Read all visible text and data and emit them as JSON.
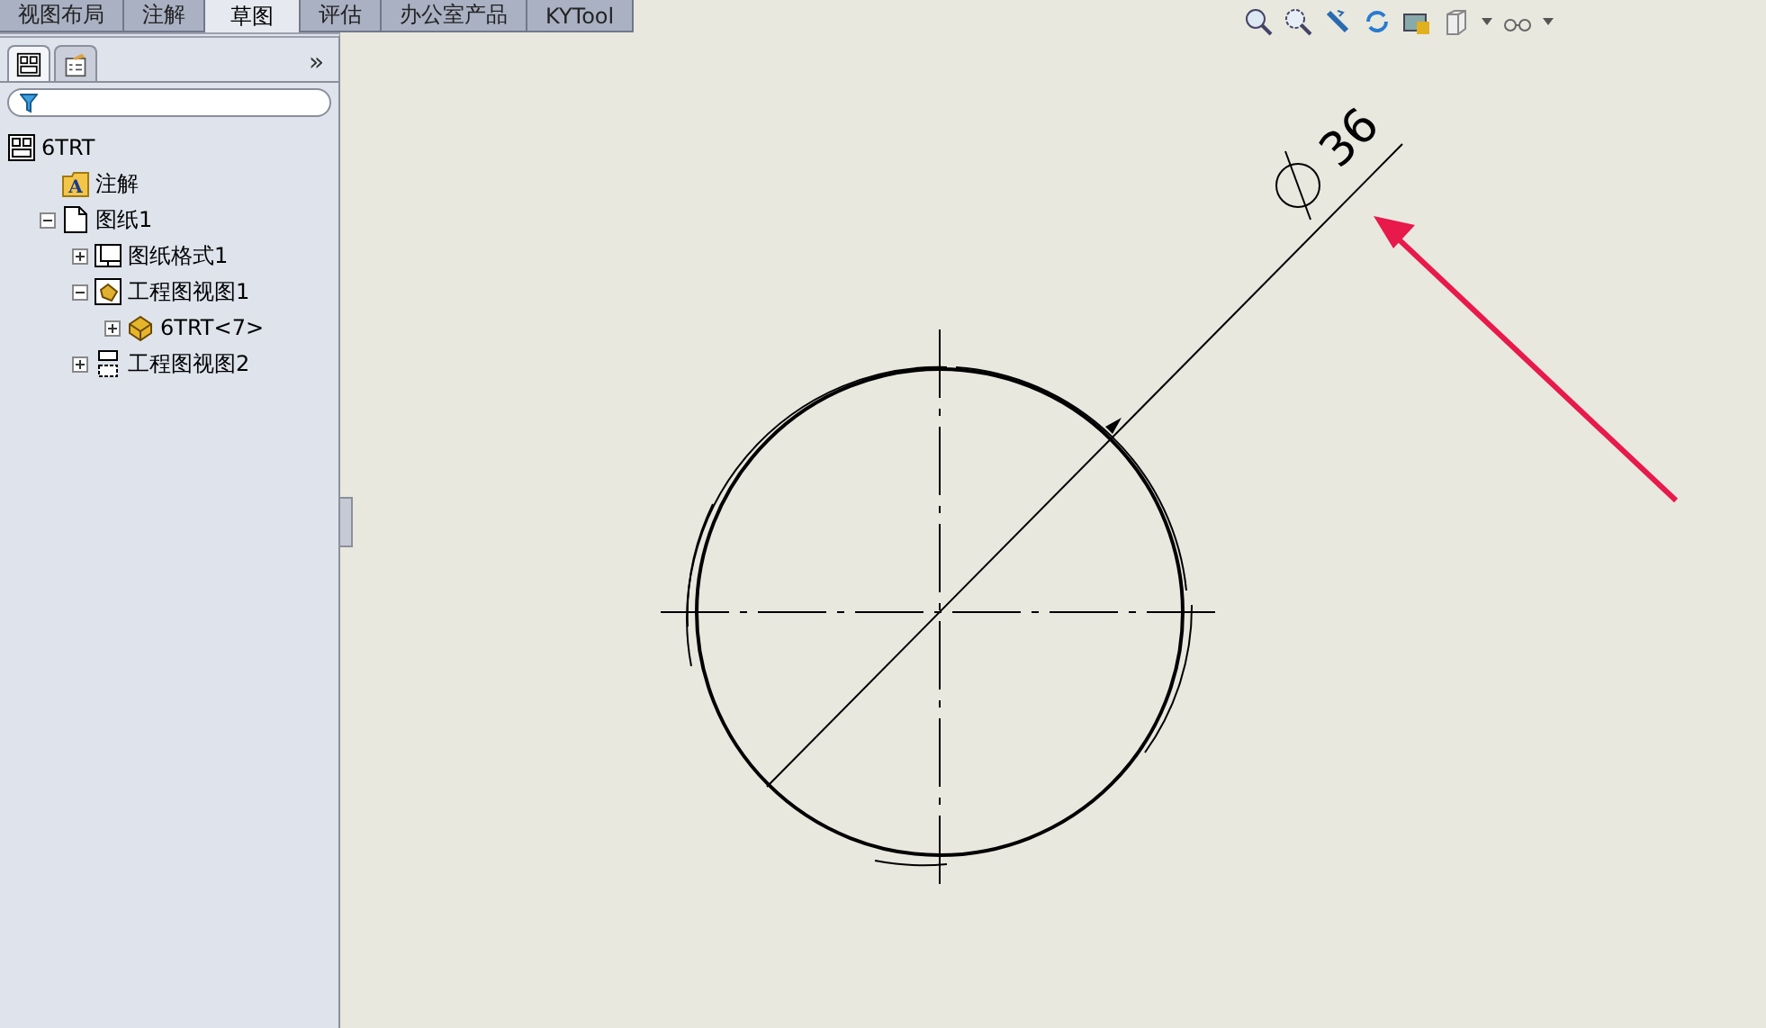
{
  "command_tabs": [
    {
      "label": "视图布局",
      "selected": false
    },
    {
      "label": "注解",
      "selected": false
    },
    {
      "label": "草图",
      "selected": true
    },
    {
      "label": "评估",
      "selected": false
    },
    {
      "label": "办公室产品",
      "selected": false
    },
    {
      "label": "KYTool",
      "selected": false
    }
  ],
  "panel_tabs": [
    {
      "kind": "tree",
      "selected": true
    },
    {
      "kind": "properties",
      "selected": false
    }
  ],
  "panel_expand": "»",
  "tree": [
    {
      "label": "6TRT",
      "kind": "drawing",
      "children": [
        {
          "label": "注解",
          "kind": "annotation",
          "icon_letter": "A"
        },
        {
          "label": "图纸1",
          "kind": "sheet",
          "expanded": true,
          "children": [
            {
              "label": "图纸格式1",
              "kind": "format",
              "expanded": false
            },
            {
              "label": "工程图视图1",
              "kind": "view",
              "expanded": true,
              "children": [
                {
                  "label": "6TRT<7>",
                  "kind": "part",
                  "expanded": false
                }
              ]
            },
            {
              "label": "工程图视图2",
              "kind": "view2",
              "expanded": false
            }
          ]
        }
      ]
    }
  ],
  "dimension": {
    "value": "36"
  }
}
